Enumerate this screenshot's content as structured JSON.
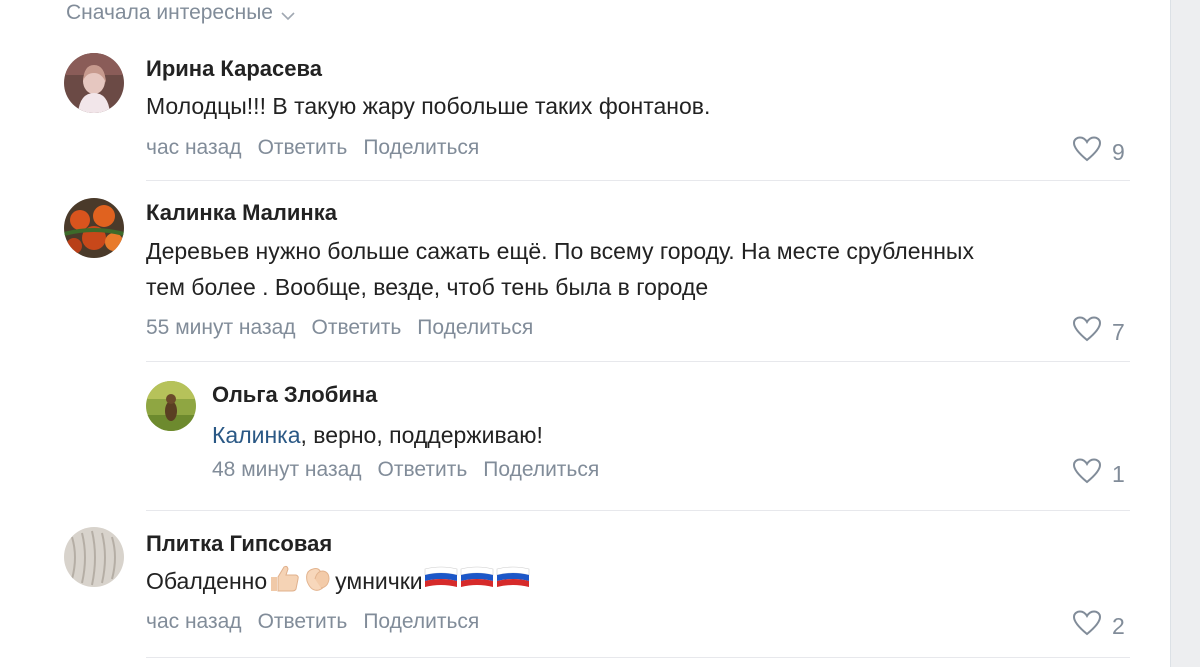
{
  "sort": {
    "label": "Сначала интересные",
    "icon": "chevron-down-icon"
  },
  "comments": [
    {
      "author": "Ирина Карасева",
      "text": "Молодцы!!! В такую жару побольше таких фонтанов.",
      "time": "час назад",
      "reply": "Ответить",
      "share": "Поделиться",
      "likes": "9"
    },
    {
      "author": "Калинка Малинка",
      "text_line1": "Деревьев нужно больше сажать ещё. По всему городу. На месте срубленных",
      "text_line2": "тем более . Вообще, везде, чтоб тень была в городе",
      "time": "55 минут назад",
      "reply": "Ответить",
      "share": "Поделиться",
      "likes": "7"
    },
    {
      "author": "Ольга Злобина",
      "mention": "Калинка",
      "text_rest": ", верно, поддерживаю!",
      "time": "48 минут назад",
      "reply": "Ответить",
      "share": "Поделиться",
      "likes": "1"
    },
    {
      "author": "Плитка Гипсовая",
      "text_part1": "Обалденно",
      "text_part2": "умнички",
      "emojis": [
        "thumbs-up-icon",
        "clapping-hands-icon",
        "russian-flag-icon",
        "russian-flag-icon",
        "russian-flag-icon"
      ],
      "time": "час назад",
      "reply": "Ответить",
      "share": "Поделиться",
      "likes": "2"
    }
  ],
  "colors": {
    "link": "#2a5885",
    "meta": "#818c99",
    "text": "#222222"
  }
}
